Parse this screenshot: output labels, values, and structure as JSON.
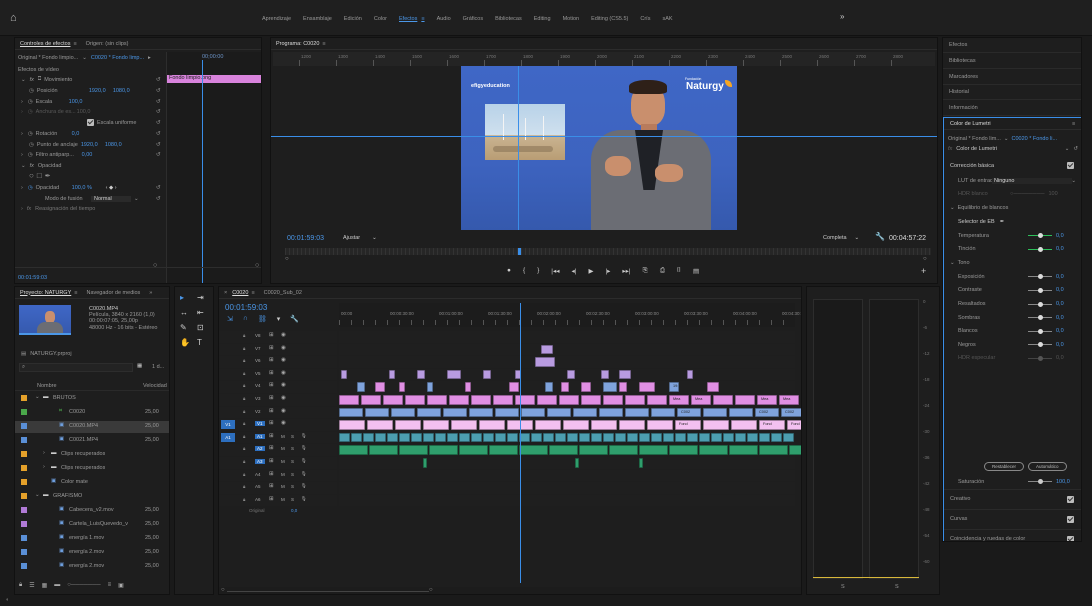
{
  "workspaces": [
    "Aprendizaje",
    "Ensamblaje",
    "Edición",
    "Color",
    "Efectos",
    "Audio",
    "Gráficos",
    "Bibliotecas",
    "Editing",
    "Motion",
    "Editing (CS5.5)",
    "Crís",
    "sAK"
  ],
  "active_workspace": "Efectos",
  "more_label": "»",
  "effect_controls": {
    "tab_active": "Controles de efectos",
    "tab_menu": "≡",
    "tab_other": "Origen: (sin clips)",
    "source_label": "Original * Fondo limpio...",
    "source_chevron": "⌄",
    "seq_label": "C0020 * Fondo limp...",
    "play_btn": "▸",
    "mini_time": "00;00:00",
    "clip_name": "Fondo limpio.png",
    "video_effects": "Efectos de vídeo",
    "movimiento": "Movimiento",
    "posicion": "Posición",
    "posicion_x": "1920,0",
    "posicion_y": "1080,0",
    "escala": "Escala",
    "escala_v": "100,0",
    "anchura": "Anchura de es...",
    "anchura_v": "100,0",
    "escala_uniforme": "Escala uniforme",
    "rotacion": "Rotación",
    "rotacion_v": "0,0",
    "anclaje": "Punto de anclaje",
    "anclaje_x": "1920,0",
    "anclaje_y": "1080,0",
    "filtro": "Filtro antiparp...",
    "filtro_v": "0,00",
    "opacidad_group": "Opacidad",
    "opacidad": "Opacidad",
    "opacidad_v": "100,0 %",
    "opacidad_nav": "‹ ◆ ›",
    "modo": "Modo de fusión",
    "modo_v": "Normal",
    "reasignacion": "Reasignación del tiempo",
    "footer_time": "00:01:59:03"
  },
  "program": {
    "title": "Programa: C0020",
    "menu": "≡",
    "ruler": [
      "1200",
      "1300",
      "1400",
      "1500",
      "1600",
      "1700",
      "1800",
      "1900",
      "2000",
      "2100",
      "2200",
      "2300",
      "2400",
      "2500",
      "2600",
      "2700",
      "2800"
    ],
    "brand_left": "efigyeducation",
    "brand_right": "Naturgy",
    "brand_sup": "Fundación",
    "timecode": "00:01:59:03",
    "fit": "Ajustar",
    "quality": "Completa",
    "duration": "00:04:57:22"
  },
  "transport": [
    "●",
    "{",
    "}",
    "|◂◂",
    "◂|",
    "▶",
    "|▸",
    "▸▸|",
    "⎘",
    "⎙",
    "⌷",
    "▤"
  ],
  "project": {
    "tab_active": "Proyecto: NATURGY",
    "tab_menu": "≡",
    "tab_other": "Navegador de medios",
    "more": "»",
    "clip_name": "C0020.MP4",
    "clip_info1": "Película, 3840 x 2160 (1,0)",
    "clip_info2": "00:00:07:05, 25,00p",
    "clip_info3": "48000 Hz - 16 bits - Estéreo",
    "project_file": "NATURGY.prproj",
    "search_placeholder": "",
    "items_count": "1 d...",
    "col_name": "Nombre",
    "col_rate": "Velocidad",
    "items": [
      {
        "name": "BRUTOS",
        "rate": "",
        "color": "#e5a12a",
        "indent": 0,
        "type": "folder"
      },
      {
        "name": "C0020",
        "rate": "25,00",
        "color": "#4aa84a",
        "indent": 2,
        "type": "seq"
      },
      {
        "name": "C0020.MP4",
        "rate": "25,00",
        "color": "#5a8fd6",
        "indent": 2,
        "type": "clip"
      },
      {
        "name": "C0021.MP4",
        "rate": "25,00",
        "color": "#5a8fd6",
        "indent": 2,
        "type": "clip"
      },
      {
        "name": "Clips recuperados",
        "rate": "",
        "color": "#e5a12a",
        "indent": 1,
        "type": "folder"
      },
      {
        "name": "Clips recuperados",
        "rate": "",
        "color": "#e5a12a",
        "indent": 1,
        "type": "folder"
      },
      {
        "name": "Color mate",
        "rate": "",
        "color": "#e5a12a",
        "indent": 1,
        "type": "clip"
      },
      {
        "name": "GRAFISMO",
        "rate": "",
        "color": "#e5a12a",
        "indent": 0,
        "type": "folder"
      },
      {
        "name": "Cabecera_v2.mov",
        "rate": "25,00",
        "color": "#b07ad6",
        "indent": 2,
        "type": "clip"
      },
      {
        "name": "Cartela_LuisQuevedo_v",
        "rate": "25,00",
        "color": "#b07ad6",
        "indent": 2,
        "type": "clip"
      },
      {
        "name": "energía 1.mov",
        "rate": "25,00",
        "color": "#5a8fd6",
        "indent": 2,
        "type": "clip"
      },
      {
        "name": "energía 2.mov",
        "rate": "25,00",
        "color": "#5a8fd6",
        "indent": 2,
        "type": "clip"
      },
      {
        "name": "energía 2.mov",
        "rate": "25,00",
        "color": "#5a8fd6",
        "indent": 2,
        "type": "clip"
      }
    ]
  },
  "tools": [
    "▸",
    "⇥",
    "↔",
    "⇤",
    "✎",
    "⊡",
    "✋",
    "T"
  ],
  "timeline": {
    "tab_active": "C0020",
    "tab_menu": "≡",
    "tab_other": "C0020_Sub_02",
    "close": "×",
    "timecode": "00:01:59:03",
    "ruler": [
      "00:00",
      "00:00:30:00",
      "00:01:00:00",
      "00:01:30:00",
      "00:02:00:00",
      "00:02:30:00",
      "00:03:00:00",
      "00:03:30:00",
      "00:04:00:00",
      "00:04:30:00"
    ],
    "video_tracks": [
      "V8",
      "V7",
      "V6",
      "V5",
      "V4",
      "V3",
      "V2",
      "V1"
    ],
    "audio_tracks": [
      "A1",
      "A2",
      "A3",
      "A4",
      "A5",
      "A6"
    ],
    "src_v": "V1",
    "src_a": "A1",
    "original_label": "Original",
    "original_val": "0,0",
    "clip_labels": {
      "v4": "19:4",
      "v3": "Mea",
      "v2": "C002",
      "v1": "Fond"
    }
  },
  "meter": {
    "scale": [
      "0",
      "-6",
      "-12",
      "-18",
      "-24",
      "-30",
      "-36",
      "-42",
      "-48",
      "-54",
      "-60"
    ],
    "footer": [
      "S",
      "S"
    ]
  },
  "right_panels": [
    "Efectos",
    "Bibliotecas",
    "Marcadores",
    "Historial",
    "Información"
  ],
  "lumetri": {
    "title": "Color de Lumetri",
    "menu": "≡",
    "source": "Original * Fondo lim...",
    "seq": "C0020 * Fondo li...",
    "effect_name": "Color de Lumetri",
    "basic": "Corrección básica",
    "lut_label": "LUT de entrada",
    "lut_value": "Ninguno",
    "hdr_label": "HDR blanco",
    "hdr_value": "100",
    "wb_section": "Equilibrio de blancos",
    "wb_selector": "Selector de EB",
    "sliders": [
      {
        "label": "Temperatura",
        "value": "0,0",
        "color": "#2dbf5a",
        "pos": 0.5
      },
      {
        "label": "Tinción",
        "value": "0,0",
        "color": "#2dbf5a",
        "pos": 0.5
      }
    ],
    "tone": "Tono",
    "tone_sliders": [
      {
        "label": "Exposición",
        "value": "0,0",
        "pos": 0.5
      },
      {
        "label": "Contraste",
        "value": "0,0",
        "pos": 0.5
      },
      {
        "label": "Resaltados",
        "value": "0,0",
        "pos": 0.5
      },
      {
        "label": "Sombras",
        "value": "0,0",
        "pos": 0.5
      },
      {
        "label": "Blancos",
        "value": "0,0",
        "pos": 0.5
      },
      {
        "label": "Negros",
        "value": "0,0",
        "pos": 0.5
      },
      {
        "label": "HDR especular",
        "value": "0,0",
        "pos": 0.5
      }
    ],
    "reset": "Restablecer",
    "auto": "Automático",
    "saturation": "Saturación",
    "saturation_value": "100,0",
    "sections": [
      "Creativo",
      "Curvas",
      "Coincidencia y ruedas de color",
      "HSL secundario",
      "Viñeta"
    ]
  },
  "colors": {
    "accent": "#4b97e8",
    "clip_v1": "#f3c0f0",
    "clip_v2": "#7fa3dc",
    "clip_v3": "#e08fe3",
    "clip_audio": "#2f9e6c",
    "playhead": "#3a8ee8"
  }
}
